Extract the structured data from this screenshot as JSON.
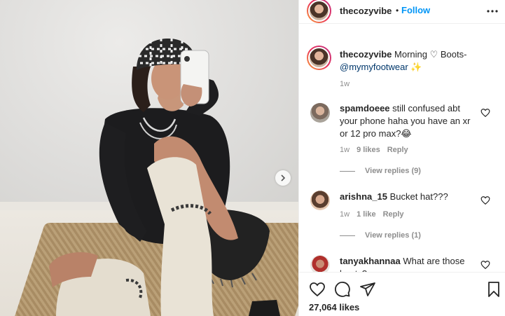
{
  "post": {
    "username": "thecozyvibe",
    "dot": "•",
    "follow_label": "Follow",
    "caption_text": "Morning ♡ Boots- ",
    "caption_mention": "@mymyfootwear",
    "caption_emoji": "✨",
    "caption_time": "1w",
    "likes": "27,064 likes"
  },
  "comments": [
    {
      "username": "spamdoeee",
      "text": "still confused abt your phone haha you have an xr or 12 pro max?😂",
      "time": "1w",
      "likes": "9 likes",
      "reply": "Reply",
      "view_replies": "View replies (9)"
    },
    {
      "username": "arishna_15",
      "text": "Bucket hat???",
      "time": "1w",
      "likes": "1 like",
      "reply": "Reply",
      "view_replies": "View replies (1)"
    },
    {
      "username": "tanyakhannaa",
      "text": "What are those boots?"
    }
  ],
  "icons": {
    "more": "more-options-icon",
    "heart": "heart-icon",
    "comment": "comment-icon",
    "share": "share-icon",
    "save": "bookmark-icon",
    "next": "chevron-right-icon"
  },
  "colors": {
    "follow": "#0095f6",
    "mention": "#00376b",
    "meta": "#8e8e8e"
  }
}
